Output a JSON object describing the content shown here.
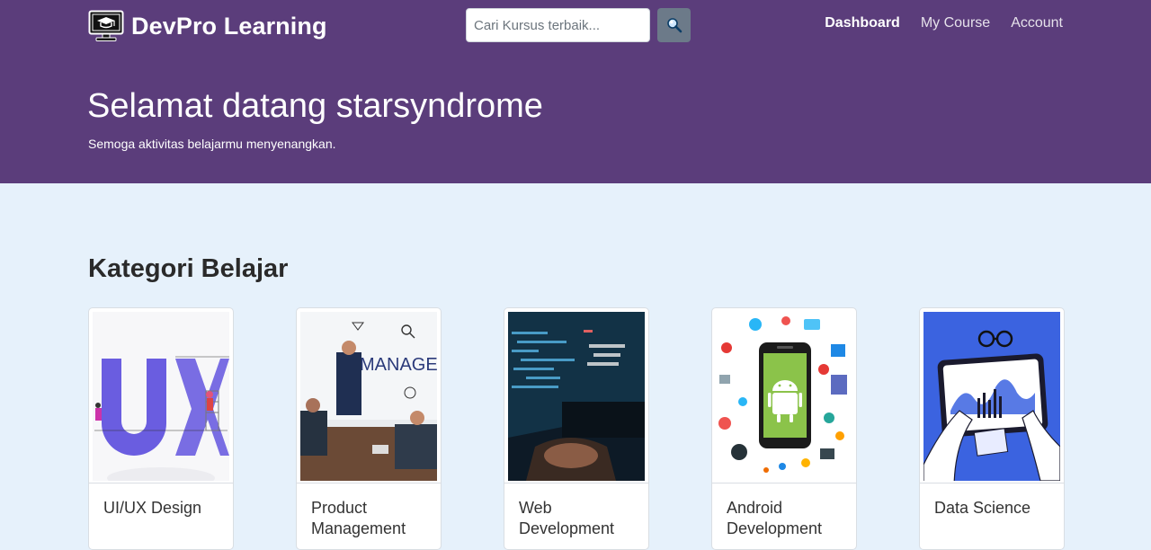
{
  "navbar": {
    "brand": "DevPro Learning",
    "brand_icon": "monitor-graduation-icon",
    "search_placeholder": "Cari Kursus terbaik...",
    "search_icon": "magnifier-icon",
    "links": [
      {
        "label": "Dashboard",
        "active": true
      },
      {
        "label": "My Course",
        "active": false
      },
      {
        "label": "Account",
        "active": false
      }
    ]
  },
  "hero": {
    "title": "Selamat datang starsyndrome",
    "subtitle": "Semoga aktivitas belajarmu menyenangkan."
  },
  "categories": {
    "heading": "Kategori Belajar",
    "items": [
      {
        "title": "UI/UX Design"
      },
      {
        "title": "Product Management"
      },
      {
        "title": "Web Development"
      },
      {
        "title": "Android Development"
      },
      {
        "title": "Data Science"
      }
    ]
  },
  "colors": {
    "header_bg": "#5b3d7b",
    "page_bg": "#e6f1fb",
    "search_button_bg": "#6c7a89"
  }
}
